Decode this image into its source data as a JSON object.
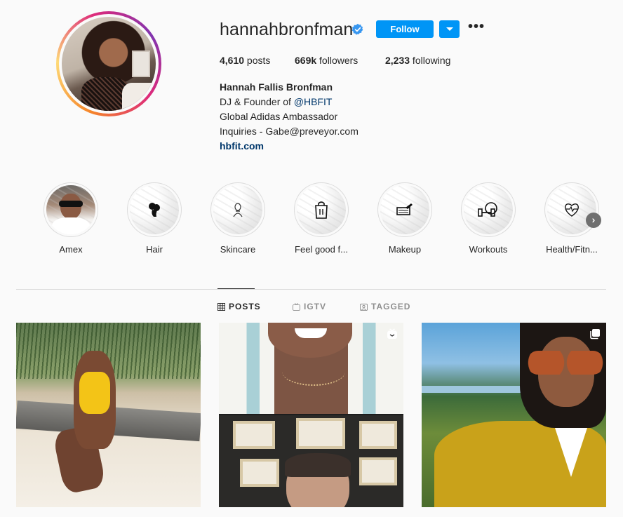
{
  "profile": {
    "username": "hannahbronfman",
    "verified": true,
    "follow_label": "Follow",
    "more_label": "•••"
  },
  "stats": {
    "posts_value": "4,610",
    "posts_label": " posts",
    "followers_value": "669k",
    "followers_label": " followers",
    "following_value": "2,233",
    "following_label": " following"
  },
  "bio": {
    "full_name": "Hannah Fallis Bronfman",
    "line1_prefix": "DJ & Founder of ",
    "line1_mention": "@HBFIT",
    "line2": "Global Adidas Ambassador",
    "line3": "Inquiries - Gabe@preveyor.com",
    "website": "hbfit.com"
  },
  "highlights": [
    {
      "label": "Amex",
      "icon": "person-photo"
    },
    {
      "label": "Hair",
      "icon": "hair-silhouette-icon"
    },
    {
      "label": "Skincare",
      "icon": "skincare-icon"
    },
    {
      "label": "Feel good f...",
      "icon": "shopping-bag-icon"
    },
    {
      "label": "Makeup",
      "icon": "makeup-icon"
    },
    {
      "label": "Workouts",
      "icon": "dumbbell-icon"
    },
    {
      "label": "Health/Fitn...",
      "icon": "heart-pulse-icon"
    }
  ],
  "next_arrow": "›",
  "tabs": [
    {
      "label": "POSTS",
      "icon": "grid-icon",
      "active": true
    },
    {
      "label": "IGTV",
      "icon": "igtv-icon",
      "active": false
    },
    {
      "label": "TAGGED",
      "icon": "tagged-icon",
      "active": false
    }
  ],
  "posts": [
    {
      "type": "photo"
    },
    {
      "type": "igtv-video",
      "icon": "igtv-icon"
    },
    {
      "type": "carousel",
      "icon": "carousel-icon"
    }
  ],
  "colors": {
    "accent": "#0095f6",
    "link": "#00376b",
    "text": "#262626",
    "muted": "#8e8e8e",
    "background": "#fafafa",
    "verified": "#3897f0"
  }
}
